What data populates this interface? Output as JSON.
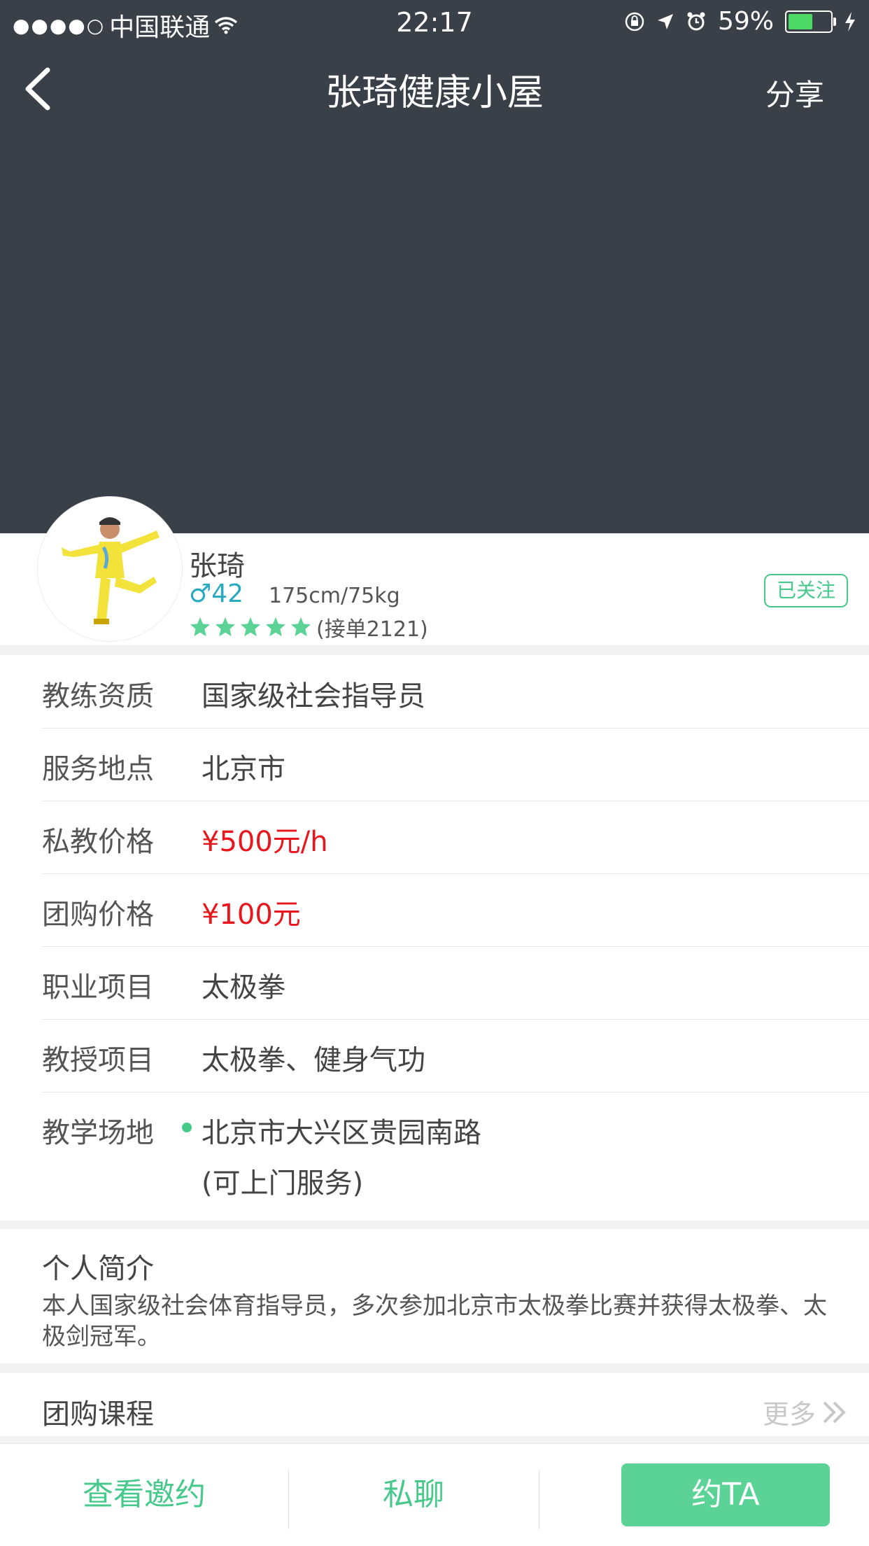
{
  "status_bar": {
    "signal_dots": "●●●●○",
    "carrier": "中国联通",
    "time": "22:17",
    "battery_percent": "59%",
    "battery_level": 0.59
  },
  "header": {
    "title": "张琦健康小屋",
    "share_label": "分享"
  },
  "profile": {
    "name": "张琦",
    "gender_age": "♂42",
    "height_weight": "175cm/75kg",
    "rating_stars": 5,
    "orders": "(接单2121)",
    "follow_label": "已关注"
  },
  "info_rows": [
    {
      "label": "教练资质",
      "value": "国家级社会指导员"
    },
    {
      "label": "服务地点",
      "value": "北京市"
    },
    {
      "label": "私教价格",
      "value": "¥500元/h"
    },
    {
      "label": "团购价格",
      "value": "¥100元"
    },
    {
      "label": "职业项目",
      "value": "太极拳"
    },
    {
      "label": "教授项目",
      "value": "太极拳、健身气功"
    },
    {
      "label": "教学场地",
      "value": "北京市大兴区贵园南路",
      "value2": "(可上门服务)"
    }
  ],
  "intro": {
    "heading": "个人简介",
    "text": "本人国家级社会体育指导员，多次参加北京市太极拳比赛并获得太极拳、太极剑冠军。"
  },
  "group_course": {
    "heading": "团购课程",
    "more_label": "更多"
  },
  "bottom_bar": {
    "invite_label": "查看邀约",
    "chat_label": "私聊",
    "book_label": "约TA"
  },
  "colors": {
    "header_bg": "#394047",
    "accent_green": "#47c98b",
    "price_red": "#e8161d",
    "gender_blue": "#2aaac1"
  }
}
